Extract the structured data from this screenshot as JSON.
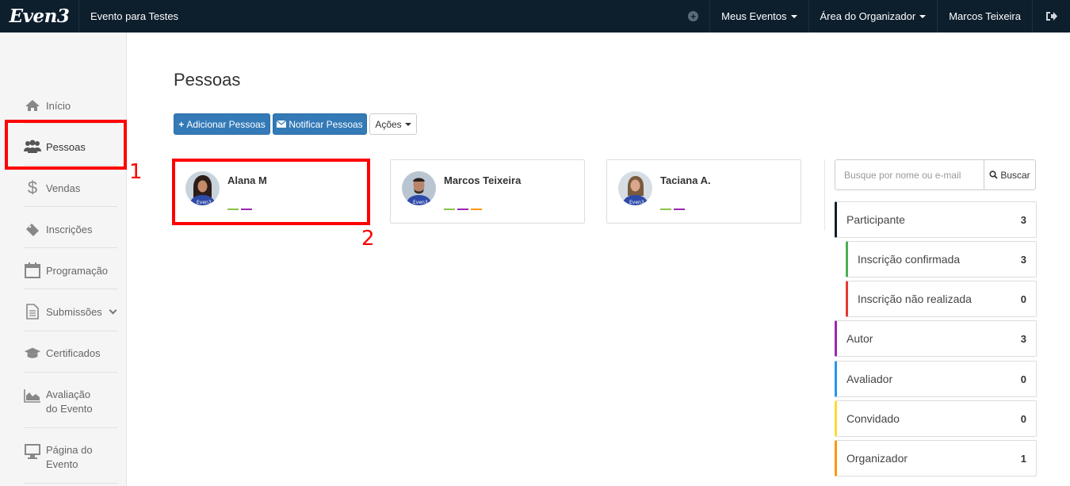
{
  "topbar": {
    "logo": "Even3",
    "event_name": "Evento para Testes",
    "menu_events": "Meus Eventos",
    "menu_organizer": "Área do Organizador",
    "user_name": "Marcos Teixeira"
  },
  "sidebar": {
    "items": [
      {
        "label": "Início",
        "icon": "home-icon"
      },
      {
        "label": "Pessoas",
        "icon": "users-icon"
      },
      {
        "label": "Vendas",
        "icon": "dollar-icon"
      },
      {
        "label": "Inscrições",
        "icon": "ticket-icon"
      },
      {
        "label": "Programação",
        "icon": "calendar-icon"
      },
      {
        "label": "Submissões",
        "icon": "document-icon"
      },
      {
        "label": "Certificados",
        "icon": "graduation-cap-icon"
      },
      {
        "label_line1": "Avaliação",
        "label_line2": "do Evento",
        "icon": "area-chart-icon"
      },
      {
        "label_line1": "Página do",
        "label_line2": "Evento",
        "icon": "monitor-icon"
      }
    ]
  },
  "annotations": {
    "box1": "1",
    "box2": "2",
    "color": "#ff0000"
  },
  "main": {
    "title": "Pessoas",
    "buttons": {
      "add": "Adicionar Pessoas",
      "notify": "Notificar Pessoas",
      "actions": "Ações"
    },
    "people": [
      {
        "name": "Alana M",
        "tags": [
          "#8bc34a",
          "#9c27b0"
        ]
      },
      {
        "name": "Marcos Teixeira",
        "tags": [
          "#8bc34a",
          "#9c27b0",
          "#ff9800"
        ]
      },
      {
        "name": "Taciana A.",
        "tags": [
          "#8bc34a",
          "#9c27b0"
        ]
      }
    ]
  },
  "search": {
    "placeholder": "Busque por nome ou e-mail",
    "button": "Buscar"
  },
  "filters": [
    {
      "label": "Participante",
      "count": "3",
      "color": "#0d1e2d"
    },
    {
      "label": "Inscrição confirmada",
      "count": "3",
      "color": "#4caf50"
    },
    {
      "label": "Inscrição não realizada",
      "count": "0",
      "color": "#e53935"
    },
    {
      "label": "Autor",
      "count": "3",
      "color": "#9c27b0"
    },
    {
      "label": "Avaliador",
      "count": "0",
      "color": "#2196f3"
    },
    {
      "label": "Convidado",
      "count": "0",
      "color": "#fdd835"
    },
    {
      "label": "Organizador",
      "count": "1",
      "color": "#ff9800"
    }
  ],
  "colors": {
    "topbar_bg": "#0d1e2d",
    "primary": "#337ab7"
  }
}
